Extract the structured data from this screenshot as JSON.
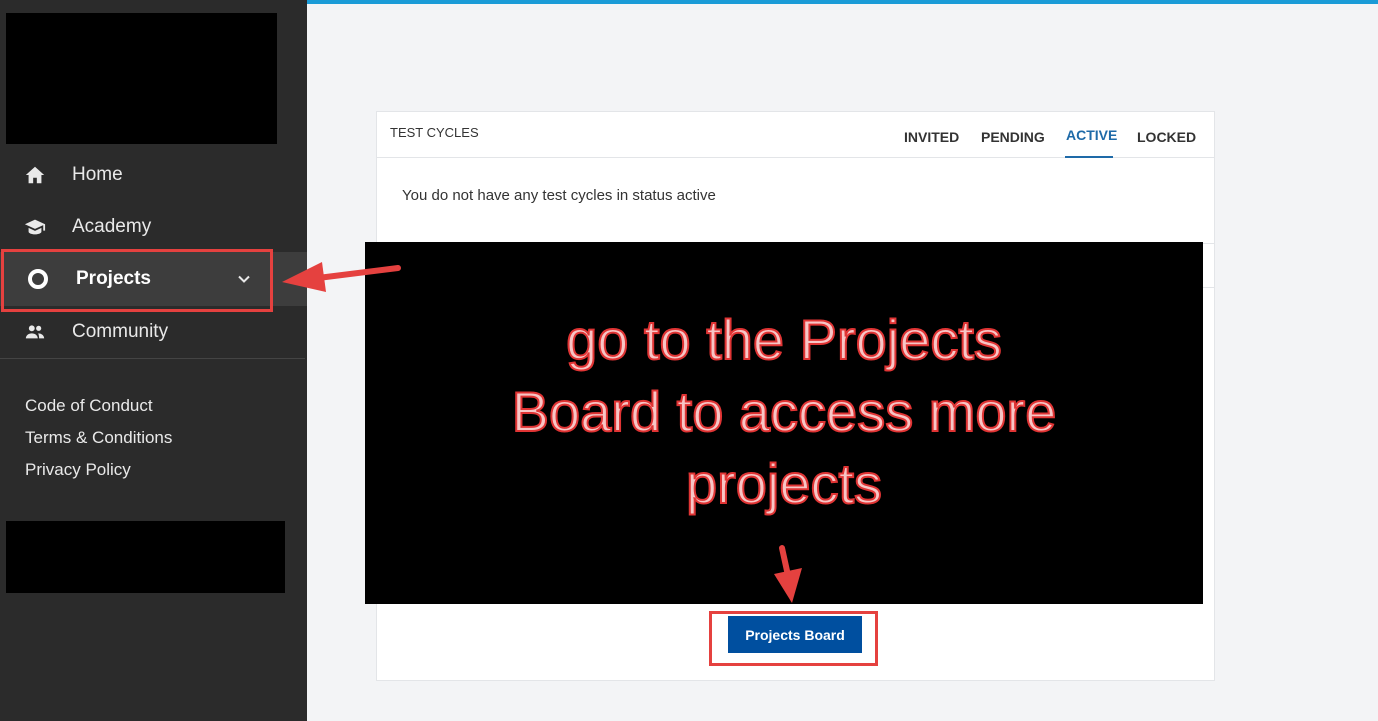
{
  "sidebar": {
    "nav": [
      {
        "label": "Home",
        "icon": "home-icon"
      },
      {
        "label": "Academy",
        "icon": "graduation-cap-icon"
      },
      {
        "label": "Projects",
        "icon": "circle-icon"
      },
      {
        "label": "Community",
        "icon": "people-icon"
      }
    ],
    "footer_links": [
      "Code of Conduct",
      "Terms & Conditions",
      "Privacy Policy"
    ]
  },
  "test_cycles": {
    "title": "TEST CYCLES",
    "tabs": [
      "INVITED",
      "PENDING",
      "ACTIVE",
      "LOCKED"
    ],
    "active_tab": "ACTIVE",
    "empty_message": "You do not have any test cycles in status active"
  },
  "overlay": {
    "lines": [
      "go to the Projects",
      "Board to access more",
      "projects"
    ]
  },
  "projects_board_button": "Projects Board",
  "colors": {
    "sidebar_bg": "#2b2b2b",
    "accent": "#1e6aa8",
    "button": "#004f9f",
    "annotation_red": "#e5413f"
  }
}
